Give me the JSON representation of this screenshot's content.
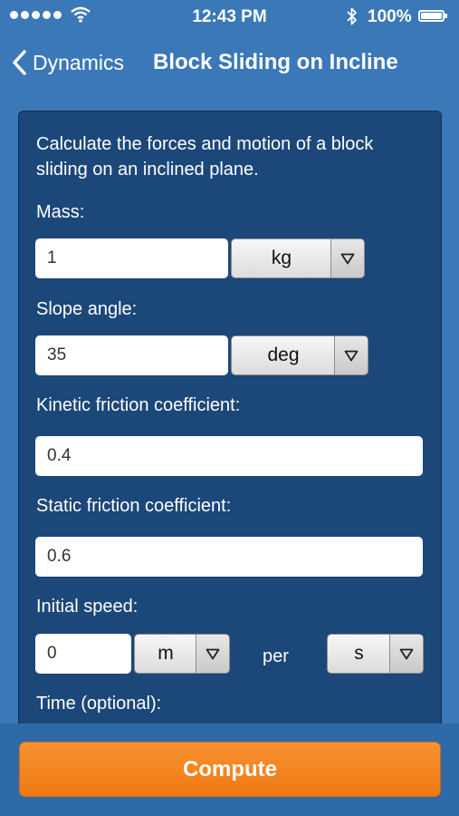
{
  "status_bar": {
    "time": "12:43 PM",
    "battery": "100%",
    "icons": [
      "signal-dots-icon",
      "wifi-icon",
      "bluetooth-icon",
      "battery-icon"
    ]
  },
  "nav": {
    "back_label": "Dynamics",
    "title": "Block Sliding on Incline"
  },
  "form": {
    "description": "Calculate the forces and motion of a block sliding on an inclined plane.",
    "mass": {
      "label": "Mass:",
      "value": "1",
      "unit": "kg"
    },
    "slope_angle": {
      "label": "Slope angle:",
      "value": "35",
      "unit": "deg"
    },
    "kinetic_friction": {
      "label": "Kinetic friction coefficient:",
      "value": "0.4"
    },
    "static_friction": {
      "label": "Static friction coefficient:",
      "value": "0.6"
    },
    "initial_speed": {
      "label": "Initial speed:",
      "value": "0",
      "distance_unit": "m",
      "per": "per",
      "time_unit": "s"
    },
    "time": {
      "label": "Time (optional):"
    }
  },
  "actions": {
    "compute_label": "Compute"
  },
  "colors": {
    "background": "#3b78b8",
    "panel": "#1c4779",
    "accent": "#f58220"
  }
}
